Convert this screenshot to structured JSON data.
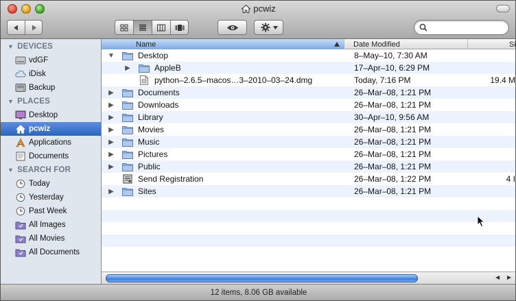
{
  "window": {
    "title": "pcwiz"
  },
  "toolbar": {
    "search_placeholder": ""
  },
  "sidebar": {
    "sections": [
      {
        "heading": "DEVICES",
        "items": [
          {
            "label": "vdGF",
            "icon": "hard-drive-icon"
          },
          {
            "label": "iDisk",
            "icon": "idisk-icon"
          },
          {
            "label": "Backup",
            "icon": "backup-drive-icon"
          }
        ]
      },
      {
        "heading": "PLACES",
        "items": [
          {
            "label": "Desktop",
            "icon": "desktop-icon"
          },
          {
            "label": "pcwiz",
            "icon": "home-icon",
            "selected": true
          },
          {
            "label": "Applications",
            "icon": "applications-icon"
          },
          {
            "label": "Documents",
            "icon": "documents-icon"
          }
        ]
      },
      {
        "heading": "SEARCH FOR",
        "items": [
          {
            "label": "Today",
            "icon": "clock-icon"
          },
          {
            "label": "Yesterday",
            "icon": "clock-icon"
          },
          {
            "label": "Past Week",
            "icon": "clock-icon"
          },
          {
            "label": "All Images",
            "icon": "smart-folder-icon"
          },
          {
            "label": "All Movies",
            "icon": "smart-folder-icon"
          },
          {
            "label": "All Documents",
            "icon": "smart-folder-icon"
          }
        ]
      }
    ]
  },
  "list": {
    "columns": {
      "name": "Name",
      "date": "Date Modified",
      "size": "Si"
    },
    "rows": [
      {
        "name": "Desktop",
        "date": "8–May–10, 7:30 AM",
        "size": "",
        "indent": 0,
        "disclosure": "open",
        "icon": "folder-icon"
      },
      {
        "name": "AppleB",
        "date": "17–Apr–10, 6:29 PM",
        "size": "",
        "indent": 1,
        "disclosure": "closed",
        "icon": "folder-icon"
      },
      {
        "name": "python–2.6.5–macos…3–2010–03–24.dmg",
        "date": "Today, 7:16 PM",
        "size": "19.4 M",
        "indent": 1,
        "disclosure": "none",
        "icon": "dmg-file-icon"
      },
      {
        "name": "Documents",
        "date": "26–Mar–08, 1:21 PM",
        "size": "",
        "indent": 0,
        "disclosure": "closed",
        "icon": "folder-icon"
      },
      {
        "name": "Downloads",
        "date": "26–Mar–08, 1:21 PM",
        "size": "",
        "indent": 0,
        "disclosure": "closed",
        "icon": "folder-icon"
      },
      {
        "name": "Library",
        "date": "30–Apr–10, 9:56 AM",
        "size": "",
        "indent": 0,
        "disclosure": "closed",
        "icon": "folder-icon"
      },
      {
        "name": "Movies",
        "date": "26–Mar–08, 1:21 PM",
        "size": "",
        "indent": 0,
        "disclosure": "closed",
        "icon": "folder-icon"
      },
      {
        "name": "Music",
        "date": "26–Mar–08, 1:21 PM",
        "size": "",
        "indent": 0,
        "disclosure": "closed",
        "icon": "folder-icon"
      },
      {
        "name": "Pictures",
        "date": "26–Mar–08, 1:21 PM",
        "size": "",
        "indent": 0,
        "disclosure": "closed",
        "icon": "folder-icon"
      },
      {
        "name": "Public",
        "date": "26–Mar–08, 1:21 PM",
        "size": "",
        "indent": 0,
        "disclosure": "closed",
        "icon": "folder-icon"
      },
      {
        "name": "Send Registration",
        "date": "26–Mar–08, 1:22 PM",
        "size": "4 I",
        "indent": 0,
        "disclosure": "none",
        "icon": "registration-file-icon"
      },
      {
        "name": "Sites",
        "date": "26–Mar–08, 1:21 PM",
        "size": "",
        "indent": 0,
        "disclosure": "closed",
        "icon": "folder-icon"
      }
    ]
  },
  "status": {
    "text": "12 items, 8.06 GB available"
  },
  "colors": {
    "selection": "#2d63c3",
    "sidebar_bg": "#dfe6ee",
    "row_alt": "#edf3fe",
    "folder": "#8fb2dd"
  }
}
